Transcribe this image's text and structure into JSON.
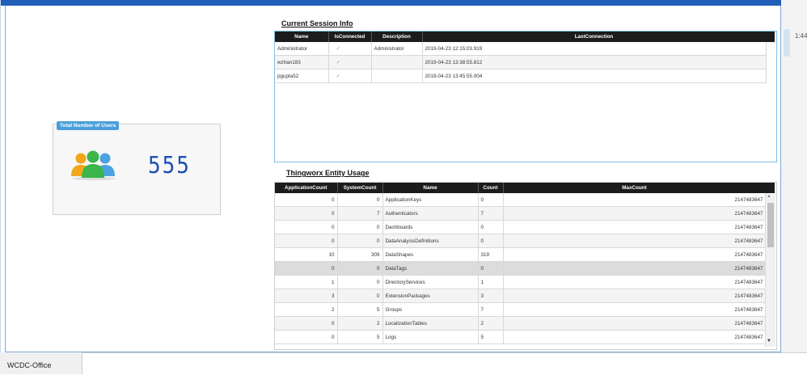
{
  "side": {
    "time": "1:44"
  },
  "taskbar": {
    "office_label": "WCDC-Office"
  },
  "users": {
    "badge": "Total Number of Users",
    "count": "555"
  },
  "session": {
    "title": "Current Session Info",
    "columns": [
      "Name",
      "IsConnected",
      "Description",
      "LastConnection"
    ],
    "rows": [
      {
        "name": "Administrator",
        "connected": "✓",
        "description": "Administrator",
        "last": "2019-04-23 12:15:03.919"
      },
      {
        "name": "wzhan183",
        "connected": "✓",
        "description": "",
        "last": "2019-04-23 13:38:55.812"
      },
      {
        "name": "pgupta52",
        "connected": "✓",
        "description": "",
        "last": "2019-04-23 13:45:55.004"
      }
    ]
  },
  "entity": {
    "title": "Thingworx Entity Usage",
    "columns": [
      "ApplicationCount",
      "SystemCount",
      "Name",
      "Count",
      "MaxCount"
    ],
    "rows": [
      {
        "app": "0",
        "sys": "0",
        "name": "ApplicationKeys",
        "count": "0",
        "max": "2147483647"
      },
      {
        "app": "0",
        "sys": "7",
        "name": "Authenticators",
        "count": "7",
        "max": "2147483647"
      },
      {
        "app": "0",
        "sys": "0",
        "name": "Dashboards",
        "count": "0",
        "max": "2147483647"
      },
      {
        "app": "0",
        "sys": "0",
        "name": "DataAnalysisDefinitions",
        "count": "0",
        "max": "2147483647"
      },
      {
        "app": "10",
        "sys": "309",
        "name": "DataShapes",
        "count": "319",
        "max": "2147483647"
      },
      {
        "app": "0",
        "sys": "0",
        "name": "DataTags",
        "count": "0",
        "max": "2147483647"
      },
      {
        "app": "1",
        "sys": "0",
        "name": "DirectoryServices",
        "count": "1",
        "max": "2147483647"
      },
      {
        "app": "3",
        "sys": "0",
        "name": "ExtensionPackages",
        "count": "3",
        "max": "2147483647"
      },
      {
        "app": "2",
        "sys": "5",
        "name": "Groups",
        "count": "7",
        "max": "2147483647"
      },
      {
        "app": "0",
        "sys": "2",
        "name": "LocalizationTables",
        "count": "2",
        "max": "2147483647"
      },
      {
        "app": "0",
        "sys": "5",
        "name": "Logs",
        "count": "5",
        "max": "2147483647"
      }
    ]
  }
}
